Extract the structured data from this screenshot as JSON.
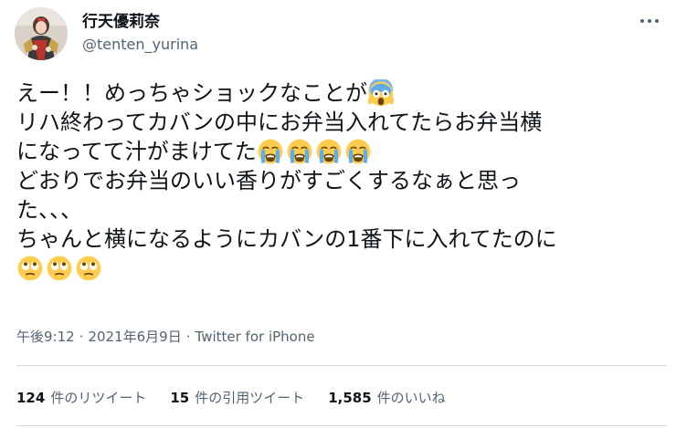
{
  "tweet": {
    "display_name": "行天優莉奈",
    "handle": "@tenten_yurina",
    "lines": {
      "l1": "えー！！めっちゃショックなことが",
      "l2": "リハ終わってカバンの中にお弁当入れてたらお弁当横",
      "l3": "になってて汁がまけてた",
      "l4": "どおりでお弁当のいい香りがすごくするなぁと思っ",
      "l5": "た、、、",
      "l6": "ちゃんと横になるようにカバンの1番下に入れてたのに"
    },
    "emojis": {
      "l1": [
        "face-screaming-in-fear"
      ],
      "l3": [
        "loudly-crying-face",
        "loudly-crying-face",
        "loudly-crying-face",
        "loudly-crying-face"
      ],
      "l7": [
        "face-with-rolling-eyes",
        "face-with-rolling-eyes",
        "face-with-rolling-eyes"
      ]
    },
    "time": "午後9:12",
    "date": "2021年6月9日",
    "source": "Twitter for iPhone",
    "separator": "·"
  },
  "stats": {
    "retweets_count": "124",
    "retweets_label": "件のリツイート",
    "quotes_count": "15",
    "quotes_label": "件の引用ツイート",
    "likes_count": "1,585",
    "likes_label": "件のいいね"
  },
  "icons": {
    "more": "more-horizontal-icon"
  }
}
